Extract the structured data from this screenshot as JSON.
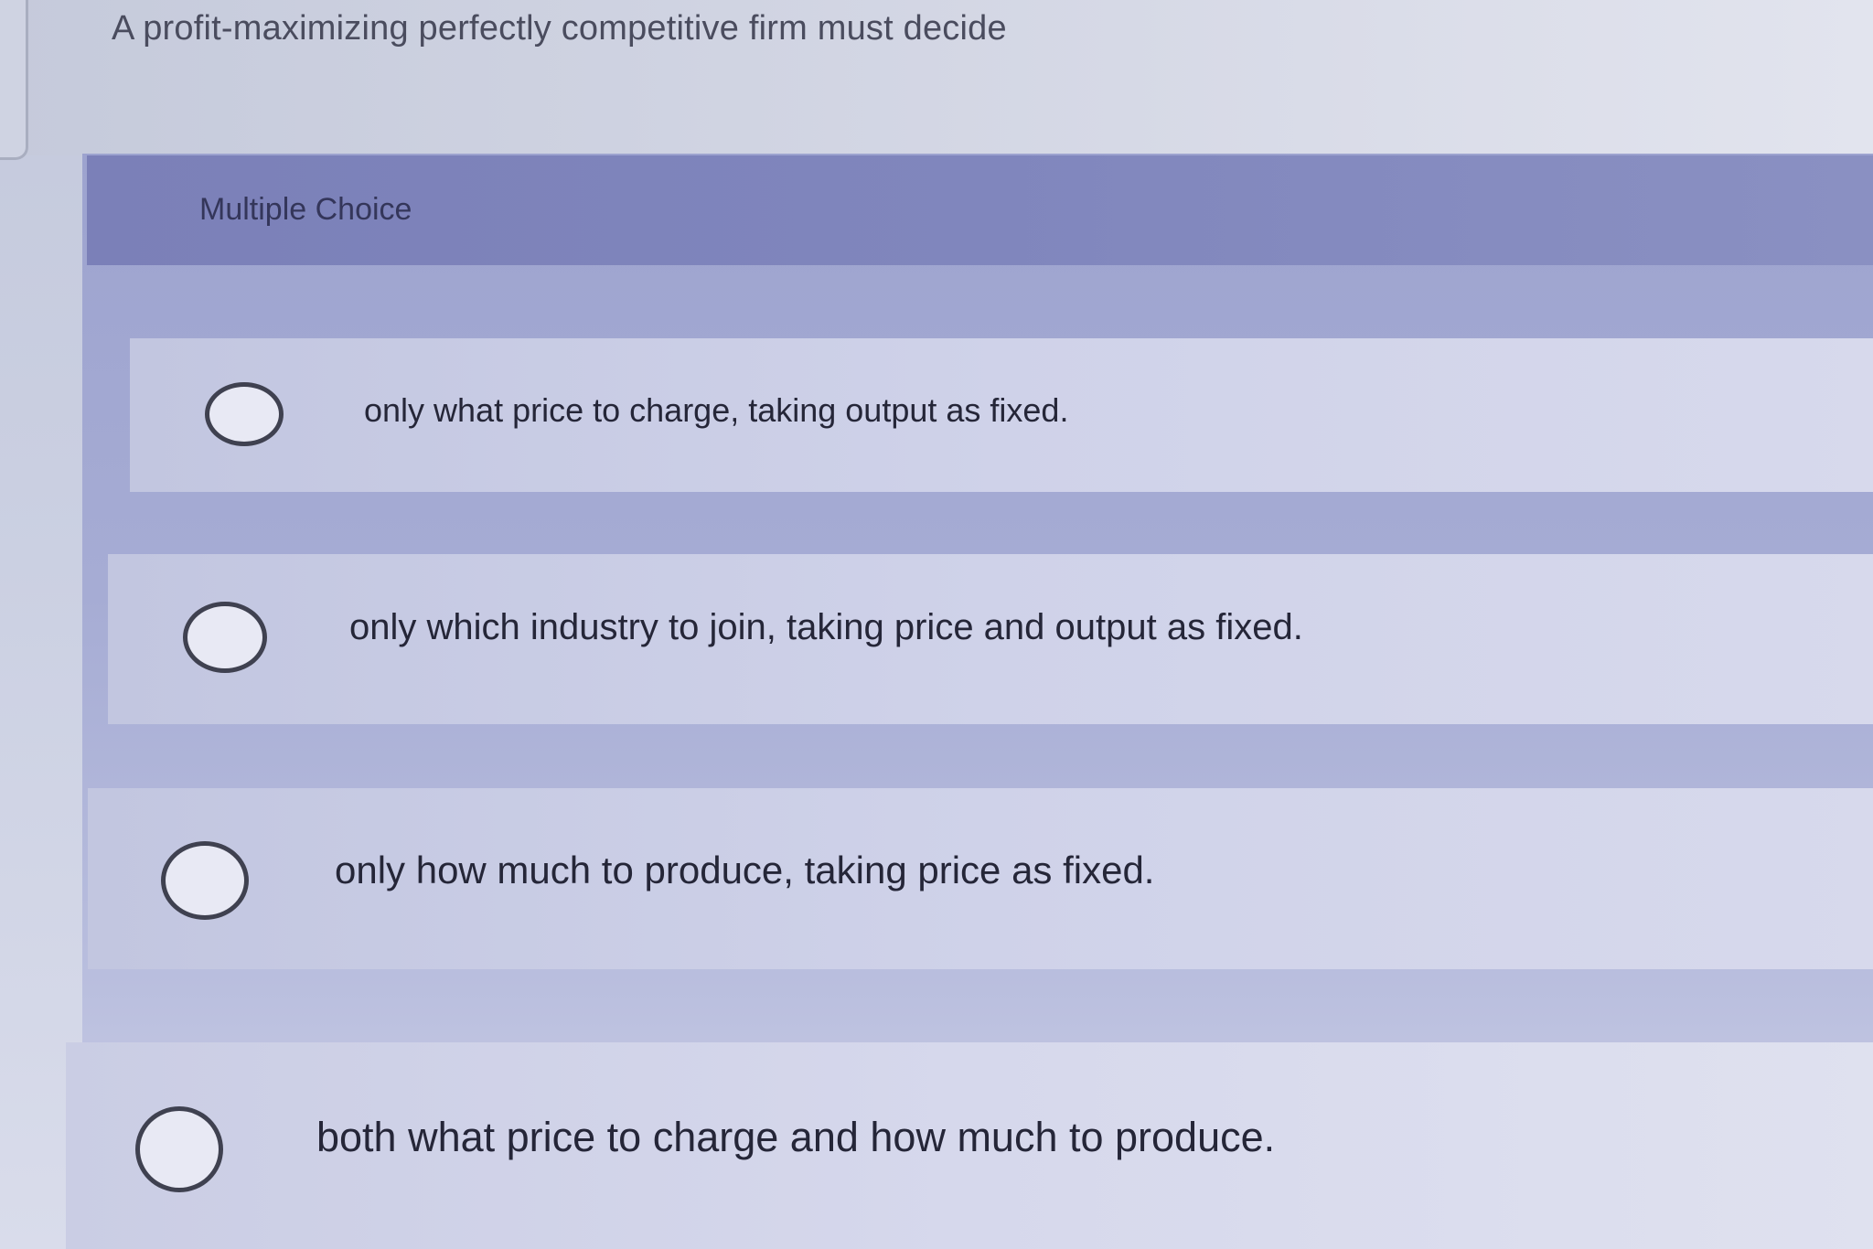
{
  "question": {
    "text": "A profit-maximizing perfectly competitive firm must decide"
  },
  "multiple_choice": {
    "header_label": "Multiple Choice",
    "options": [
      {
        "label": "only what price to charge, taking output as fixed.",
        "selected": false
      },
      {
        "label": "only which industry to join, taking price and output as fixed.",
        "selected": false
      },
      {
        "label": "only how much to produce, taking price as fixed.",
        "selected": false
      },
      {
        "label": "both what price to charge and how much to produce.",
        "selected": false
      }
    ]
  },
  "colors": {
    "header_band": "#7b80b8",
    "option_background": "#cfd2e9",
    "text": "#252638",
    "radio_border": "#3f4150"
  }
}
